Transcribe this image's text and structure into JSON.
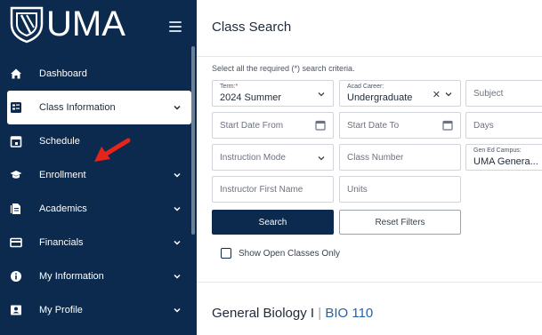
{
  "logo": {
    "text": "UMA"
  },
  "sidebar": {
    "items": [
      {
        "label": "Dashboard",
        "icon": "home-icon",
        "has_chevron": false,
        "active": false
      },
      {
        "label": "Class Information",
        "icon": "class-info-icon",
        "has_chevron": true,
        "active": true
      },
      {
        "label": "Schedule",
        "icon": "calendar-icon",
        "has_chevron": false,
        "active": false
      },
      {
        "label": "Enrollment",
        "icon": "graduation-cap-icon",
        "has_chevron": true,
        "active": false
      },
      {
        "label": "Academics",
        "icon": "document-icon",
        "has_chevron": true,
        "active": false
      },
      {
        "label": "Financials",
        "icon": "credit-card-icon",
        "has_chevron": true,
        "active": false
      },
      {
        "label": "My Information",
        "icon": "info-icon",
        "has_chevron": true,
        "active": false
      },
      {
        "label": "My Profile",
        "icon": "profile-card-icon",
        "has_chevron": true,
        "active": false
      }
    ]
  },
  "header": {
    "title": "Class Search"
  },
  "form": {
    "instructions": "Select all the required (*) search criteria.",
    "term": {
      "label": "Term:",
      "required_mark": "*",
      "value": "2024 Summer"
    },
    "acad_career": {
      "label": "Acad Career:",
      "value": "Undergraduate"
    },
    "subject": {
      "placeholder": "Subject"
    },
    "start_date_from": {
      "placeholder": "Start Date From"
    },
    "start_date_to": {
      "placeholder": "Start Date To"
    },
    "days": {
      "placeholder": "Days"
    },
    "instruction_mode": {
      "placeholder": "Instruction Mode"
    },
    "class_number": {
      "placeholder": "Class Number"
    },
    "gen_ed_campus": {
      "label": "Gen Ed Campus:",
      "value": "UMA Genera..."
    },
    "instructor_first_name": {
      "placeholder": "Instructor First Name"
    },
    "units": {
      "placeholder": "Units"
    },
    "search_label": "Search",
    "reset_label": "Reset Filters",
    "open_only_label": "Show Open Classes Only"
  },
  "result": {
    "course_name": "General Biology I",
    "separator": "|",
    "course_code": "BIO 110"
  },
  "colors": {
    "sidebar": "#0b2a4e",
    "accent": "#0b2a4e",
    "required": "#dc2626",
    "arrow": "#e8231a"
  }
}
